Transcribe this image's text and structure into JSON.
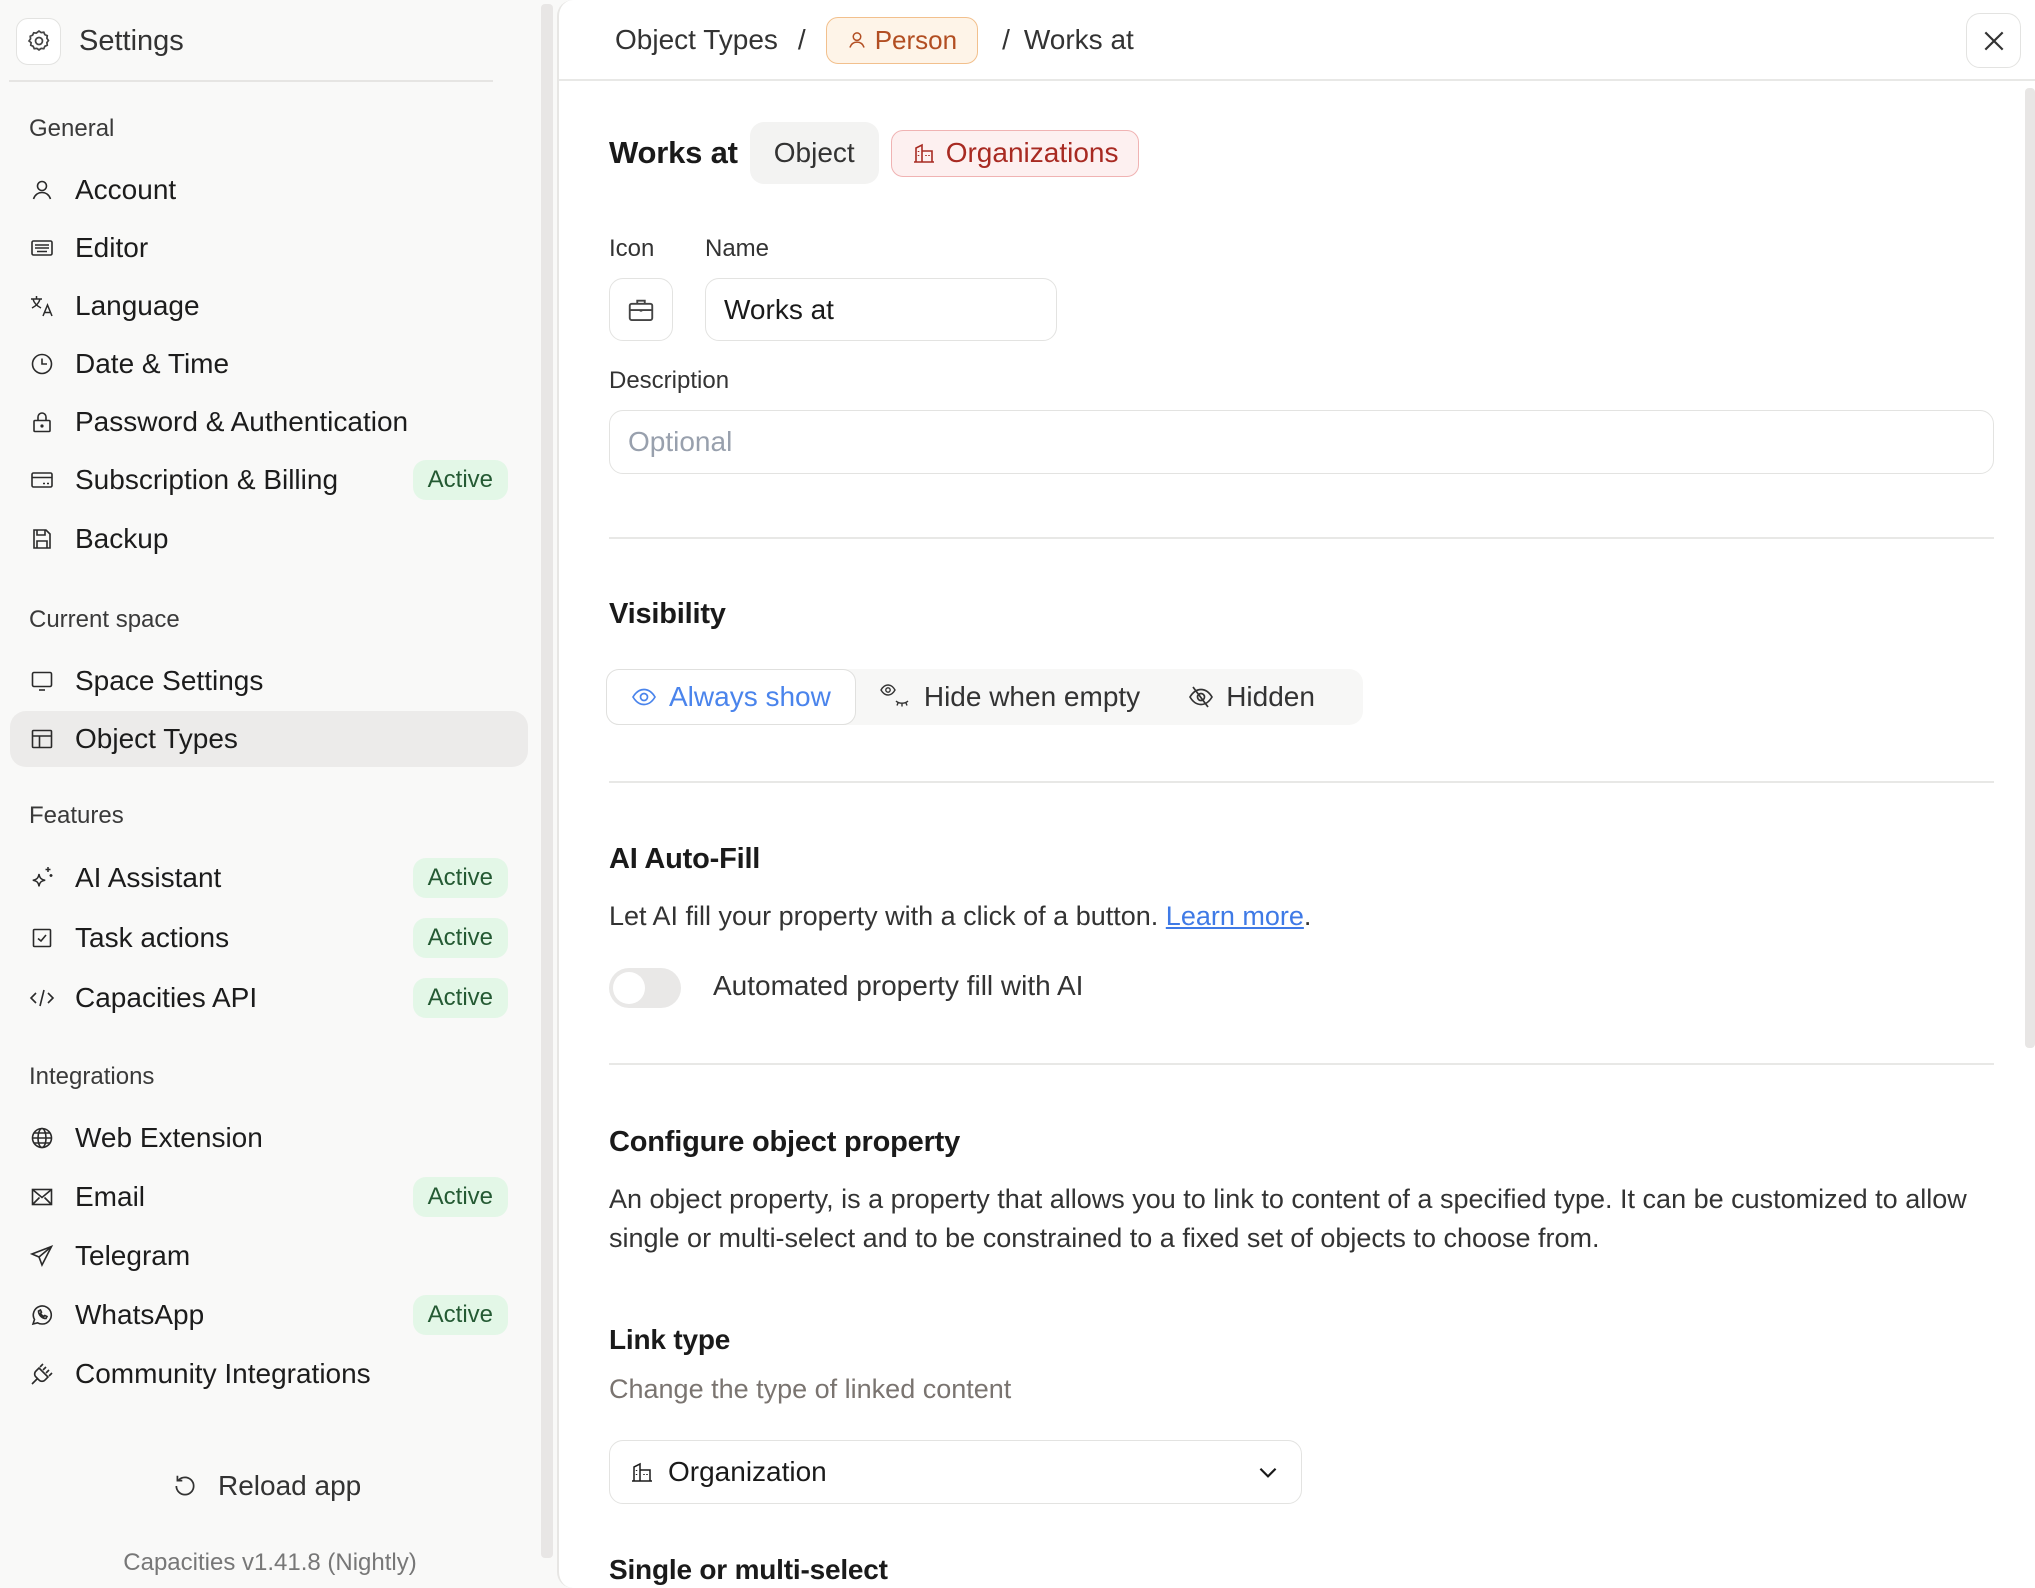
{
  "sidebar": {
    "title": "Settings",
    "sections": [
      {
        "label": "General",
        "items": [
          {
            "label": "Account",
            "icon": "user-icon",
            "badge": null
          },
          {
            "label": "Editor",
            "icon": "keyboard-icon",
            "badge": null
          },
          {
            "label": "Language",
            "icon": "translate-icon",
            "badge": null
          },
          {
            "label": "Date & Time",
            "icon": "clock-icon",
            "badge": null
          },
          {
            "label": "Password & Authentication",
            "icon": "lock-icon",
            "badge": null
          },
          {
            "label": "Subscription & Billing",
            "icon": "credit-card-icon",
            "badge": "Active"
          },
          {
            "label": "Backup",
            "icon": "floppy-disk-icon",
            "badge": null
          }
        ]
      },
      {
        "label": "Current space",
        "items": [
          {
            "label": "Space Settings",
            "icon": "monitor-icon",
            "badge": null
          },
          {
            "label": "Object Types",
            "icon": "layout-icon",
            "badge": null,
            "active": true
          }
        ]
      },
      {
        "label": "Features",
        "items": [
          {
            "label": "AI Assistant",
            "icon": "sparkle-icon",
            "badge": "Active"
          },
          {
            "label": "Task actions",
            "icon": "checkbox-icon",
            "badge": "Active"
          },
          {
            "label": "Capacities API",
            "icon": "code-icon",
            "badge": "Active"
          }
        ]
      },
      {
        "label": "Integrations",
        "items": [
          {
            "label": "Web Extension",
            "icon": "globe-icon",
            "badge": null
          },
          {
            "label": "Email",
            "icon": "envelope-icon",
            "badge": "Active"
          },
          {
            "label": "Telegram",
            "icon": "paper-plane-icon",
            "badge": null
          },
          {
            "label": "WhatsApp",
            "icon": "whatsapp-icon",
            "badge": "Active"
          },
          {
            "label": "Community Integrations",
            "icon": "plug-icon",
            "badge": null
          }
        ]
      }
    ],
    "reload_label": "Reload app",
    "version": "Capacities v1.41.8 (Nightly)"
  },
  "breadcrumb": {
    "root": "Object Types",
    "separator": "/",
    "type_chip": "Person",
    "current": "Works at"
  },
  "property": {
    "title": "Works at",
    "kind_chip": "Object",
    "target_chip": "Organizations",
    "icon_label": "Icon",
    "icon": "briefcase-icon",
    "name_label": "Name",
    "name_value": "Works at",
    "description_label": "Description",
    "description_value": "",
    "description_placeholder": "Optional"
  },
  "visibility": {
    "title": "Visibility",
    "options": [
      {
        "label": "Always show",
        "icon": "eye-icon",
        "selected": true
      },
      {
        "label": "Hide when empty",
        "icon": "eye-closed-icon",
        "selected": false
      },
      {
        "label": "Hidden",
        "icon": "eye-off-icon",
        "selected": false
      }
    ]
  },
  "ai_autofill": {
    "title": "AI Auto-Fill",
    "description": "Let AI fill your property with a click of a button.",
    "link_label": "Learn more",
    "link_suffix": ".",
    "toggle_label": "Automated property fill with AI",
    "toggle_on": false
  },
  "configure": {
    "title": "Configure object property",
    "description": "An object property, is a property that allows you to link to content of a specified type. It can be customized to allow single or multi-select and to be constrained to a fixed set of objects to choose from.",
    "link_type_title": "Link type",
    "link_type_subtitle": "Change the type of linked content",
    "link_type_value": "Organization",
    "select_mode_title": "Single or multi-select"
  },
  "colors": {
    "accent_blue": "#4a84ec",
    "badge_bg": "#e3f7e7",
    "badge_text": "#245a33",
    "person_chip": "#b24e22",
    "org_chip": "#a82a22"
  }
}
